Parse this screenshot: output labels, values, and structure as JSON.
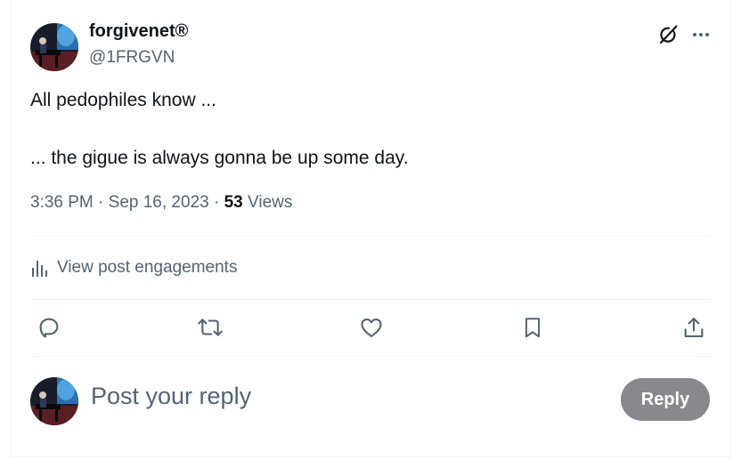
{
  "author": {
    "display_name": "forgivenet®",
    "handle": "@1FRGVN"
  },
  "post": {
    "line1": "All pedophiles know ...",
    "line2": "... the gigue is always gonna be up some day."
  },
  "meta": {
    "time": "3:36 PM",
    "separator1": " · ",
    "date": "Sep 16, 2023",
    "separator2": " · ",
    "views_count": "53",
    "views_label": " Views"
  },
  "engagements": {
    "label": "View post engagements"
  },
  "reply": {
    "placeholder": "Post your reply",
    "button_label": "Reply"
  },
  "icons": {
    "grok": "grok-icon",
    "more": "more-icon",
    "stats": "stats-icon",
    "comment": "comment-icon",
    "repost": "repost-icon",
    "like": "heart-icon",
    "bookmark": "bookmark-icon",
    "share": "share-icon"
  },
  "colors": {
    "text_primary": "#0f1419",
    "text_secondary": "#536471",
    "divider": "#eff3f4",
    "reply_button_bg": "#87898c"
  }
}
